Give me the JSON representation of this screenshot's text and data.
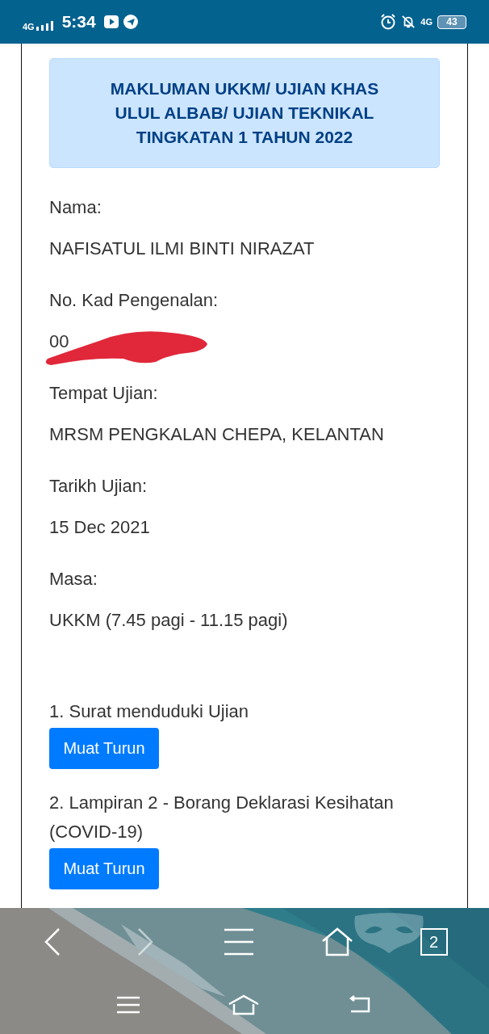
{
  "status_bar": {
    "network": "4G",
    "time": "5:34",
    "network_2": "4G",
    "battery": "43"
  },
  "notice": {
    "title": "MAKLUMAN UKKM/ UJIAN KHAS ULUL ALBAB/ UJIAN TEKNIKAL TINGKATAN 1 TAHUN 2022"
  },
  "fields": [
    {
      "label": "Nama:",
      "value": "NAFISATUL ILMI BINTI NIRAZAT",
      "redacted": false
    },
    {
      "label": "No. Kad Pengenalan:",
      "value": "00",
      "redacted": true
    },
    {
      "label": "Tempat Ujian:",
      "value": "MRSM PENGKALAN CHEPA, KELANTAN",
      "redacted": false
    },
    {
      "label": "Tarikh Ujian:",
      "value": "15 Dec 2021",
      "redacted": false
    },
    {
      "label": "Masa:",
      "value": "UKKM (7.45 pagi - 11.15 pagi)",
      "redacted": false
    }
  ],
  "documents": [
    {
      "label": "1. Surat menduduki Ujian",
      "button": "Muat Turun"
    },
    {
      "label": "2. Lampiran 2 - Borang Deklarasi Kesihatan (COVID-19)",
      "button": "Muat Turun"
    }
  ],
  "browser_toolbar": {
    "back_disabled": false,
    "forward_disabled": true,
    "tab_count": "2"
  }
}
